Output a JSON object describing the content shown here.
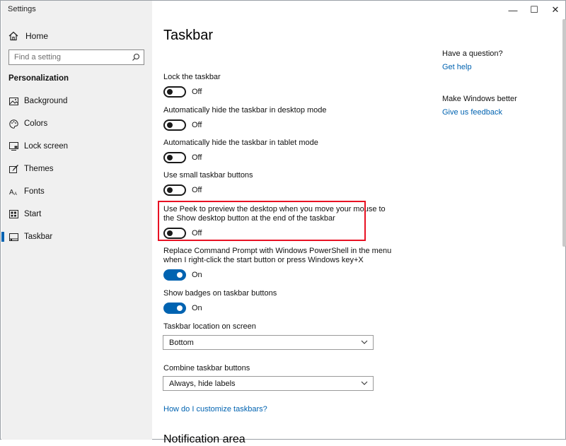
{
  "window": {
    "title": "Settings",
    "controls": {
      "minimize": "—",
      "maximize": "☐",
      "close": "✕"
    }
  },
  "sidebar": {
    "home_label": "Home",
    "search_placeholder": "Find a setting",
    "section_label": "Personalization",
    "items": [
      {
        "label": "Background",
        "icon": "image-icon",
        "active": false
      },
      {
        "label": "Colors",
        "icon": "palette-icon",
        "active": false
      },
      {
        "label": "Lock screen",
        "icon": "lock-screen-icon",
        "active": false
      },
      {
        "label": "Themes",
        "icon": "brush-icon",
        "active": false
      },
      {
        "label": "Fonts",
        "icon": "font-icon",
        "active": false
      },
      {
        "label": "Start",
        "icon": "start-icon",
        "active": false
      },
      {
        "label": "Taskbar",
        "icon": "taskbar-icon",
        "active": true
      }
    ]
  },
  "main": {
    "title": "Taskbar",
    "settings": [
      {
        "label": "Lock the taskbar",
        "state": "Off",
        "on": false
      },
      {
        "label": "Automatically hide the taskbar in desktop mode",
        "state": "Off",
        "on": false
      },
      {
        "label": "Automatically hide the taskbar in tablet mode",
        "state": "Off",
        "on": false
      },
      {
        "label": "Use small taskbar buttons",
        "state": "Off",
        "on": false
      },
      {
        "label_line1": "Use Peek to preview the desktop when you move your mouse to",
        "label_line2": "the Show desktop button at the end of the taskbar",
        "state": "Off",
        "on": false
      },
      {
        "label_line1": "Replace Command Prompt with Windows PowerShell in the menu",
        "label_line2": "when I right-click the start button or press Windows key+X",
        "state": "On",
        "on": true
      },
      {
        "label": "Show badges on taskbar buttons",
        "state": "On",
        "on": true
      }
    ],
    "location": {
      "label": "Taskbar location on screen",
      "value": "Bottom"
    },
    "combine": {
      "label": "Combine taskbar buttons",
      "value": "Always, hide labels"
    },
    "customize_link": "How do I customize taskbars?",
    "next_section": "Notification area"
  },
  "help": {
    "question_heading": "Have a question?",
    "get_help": "Get help",
    "better_heading": "Make Windows better",
    "feedback": "Give us feedback"
  },
  "colors": {
    "accent": "#0063b1",
    "highlight": "#e81123",
    "sidebar_bg": "#f0f0f0"
  }
}
